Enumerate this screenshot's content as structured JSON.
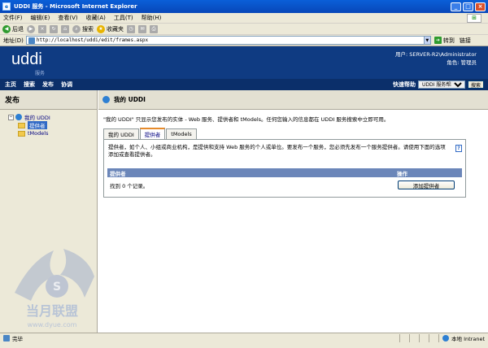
{
  "window": {
    "title": "UDDI 服务 - Microsoft Internet Explorer",
    "min": "_",
    "max": "□",
    "close": "×"
  },
  "menu": [
    "文件(F)",
    "编辑(E)",
    "查看(V)",
    "收藏(A)",
    "工具(T)",
    "帮助(H)"
  ],
  "toolbar": {
    "back": "后退",
    "search": "搜索",
    "favorites": "收藏夹"
  },
  "address": {
    "label": "地址(D)",
    "url": "http://localhost/uddi/edit/frames.aspx",
    "go": "转到",
    "links": "链接"
  },
  "banner": {
    "logo": "uddi",
    "logo_sub": "服务",
    "user": "用户: SERVER-R2\\Administrator",
    "role": "角色: 管理员"
  },
  "nav": {
    "items": [
      "主页",
      "搜索",
      "发布",
      "协调"
    ],
    "quick_help": "快速帮助",
    "help_option": "UDDI 服务帮助",
    "search_btn": "搜索"
  },
  "sidebar": {
    "title": "发布",
    "root": "我的 UDDI",
    "children": [
      "提供者",
      "tModels"
    ]
  },
  "main": {
    "title": "我的 UDDI",
    "intro": "\"我的 UDDI\" 只显示您发布的实体 - Web 服务、提供者和 tModels。任何您输入的信息都在 UDDI 服务搜索中立即可用。",
    "tabs": [
      "我的 UDDI",
      "提供者",
      "tModels"
    ],
    "description": "提供者，如个人、小组或商业机构，是提供和支持 Web 服务的个人或单位。要发布一个服务，您必须先发布一个服务提供者。请使用下面的选项添加或查看提供者。",
    "table_headers": [
      "提供者",
      "操作"
    ],
    "found": "找到 0 个记录。",
    "add_button": "添加提供者",
    "help_mark": "?"
  },
  "status": {
    "text": "完毕",
    "zone": "本地 Intranet"
  },
  "watermark": {
    "text": "当月联盟",
    "url": "www.dyue.com"
  }
}
